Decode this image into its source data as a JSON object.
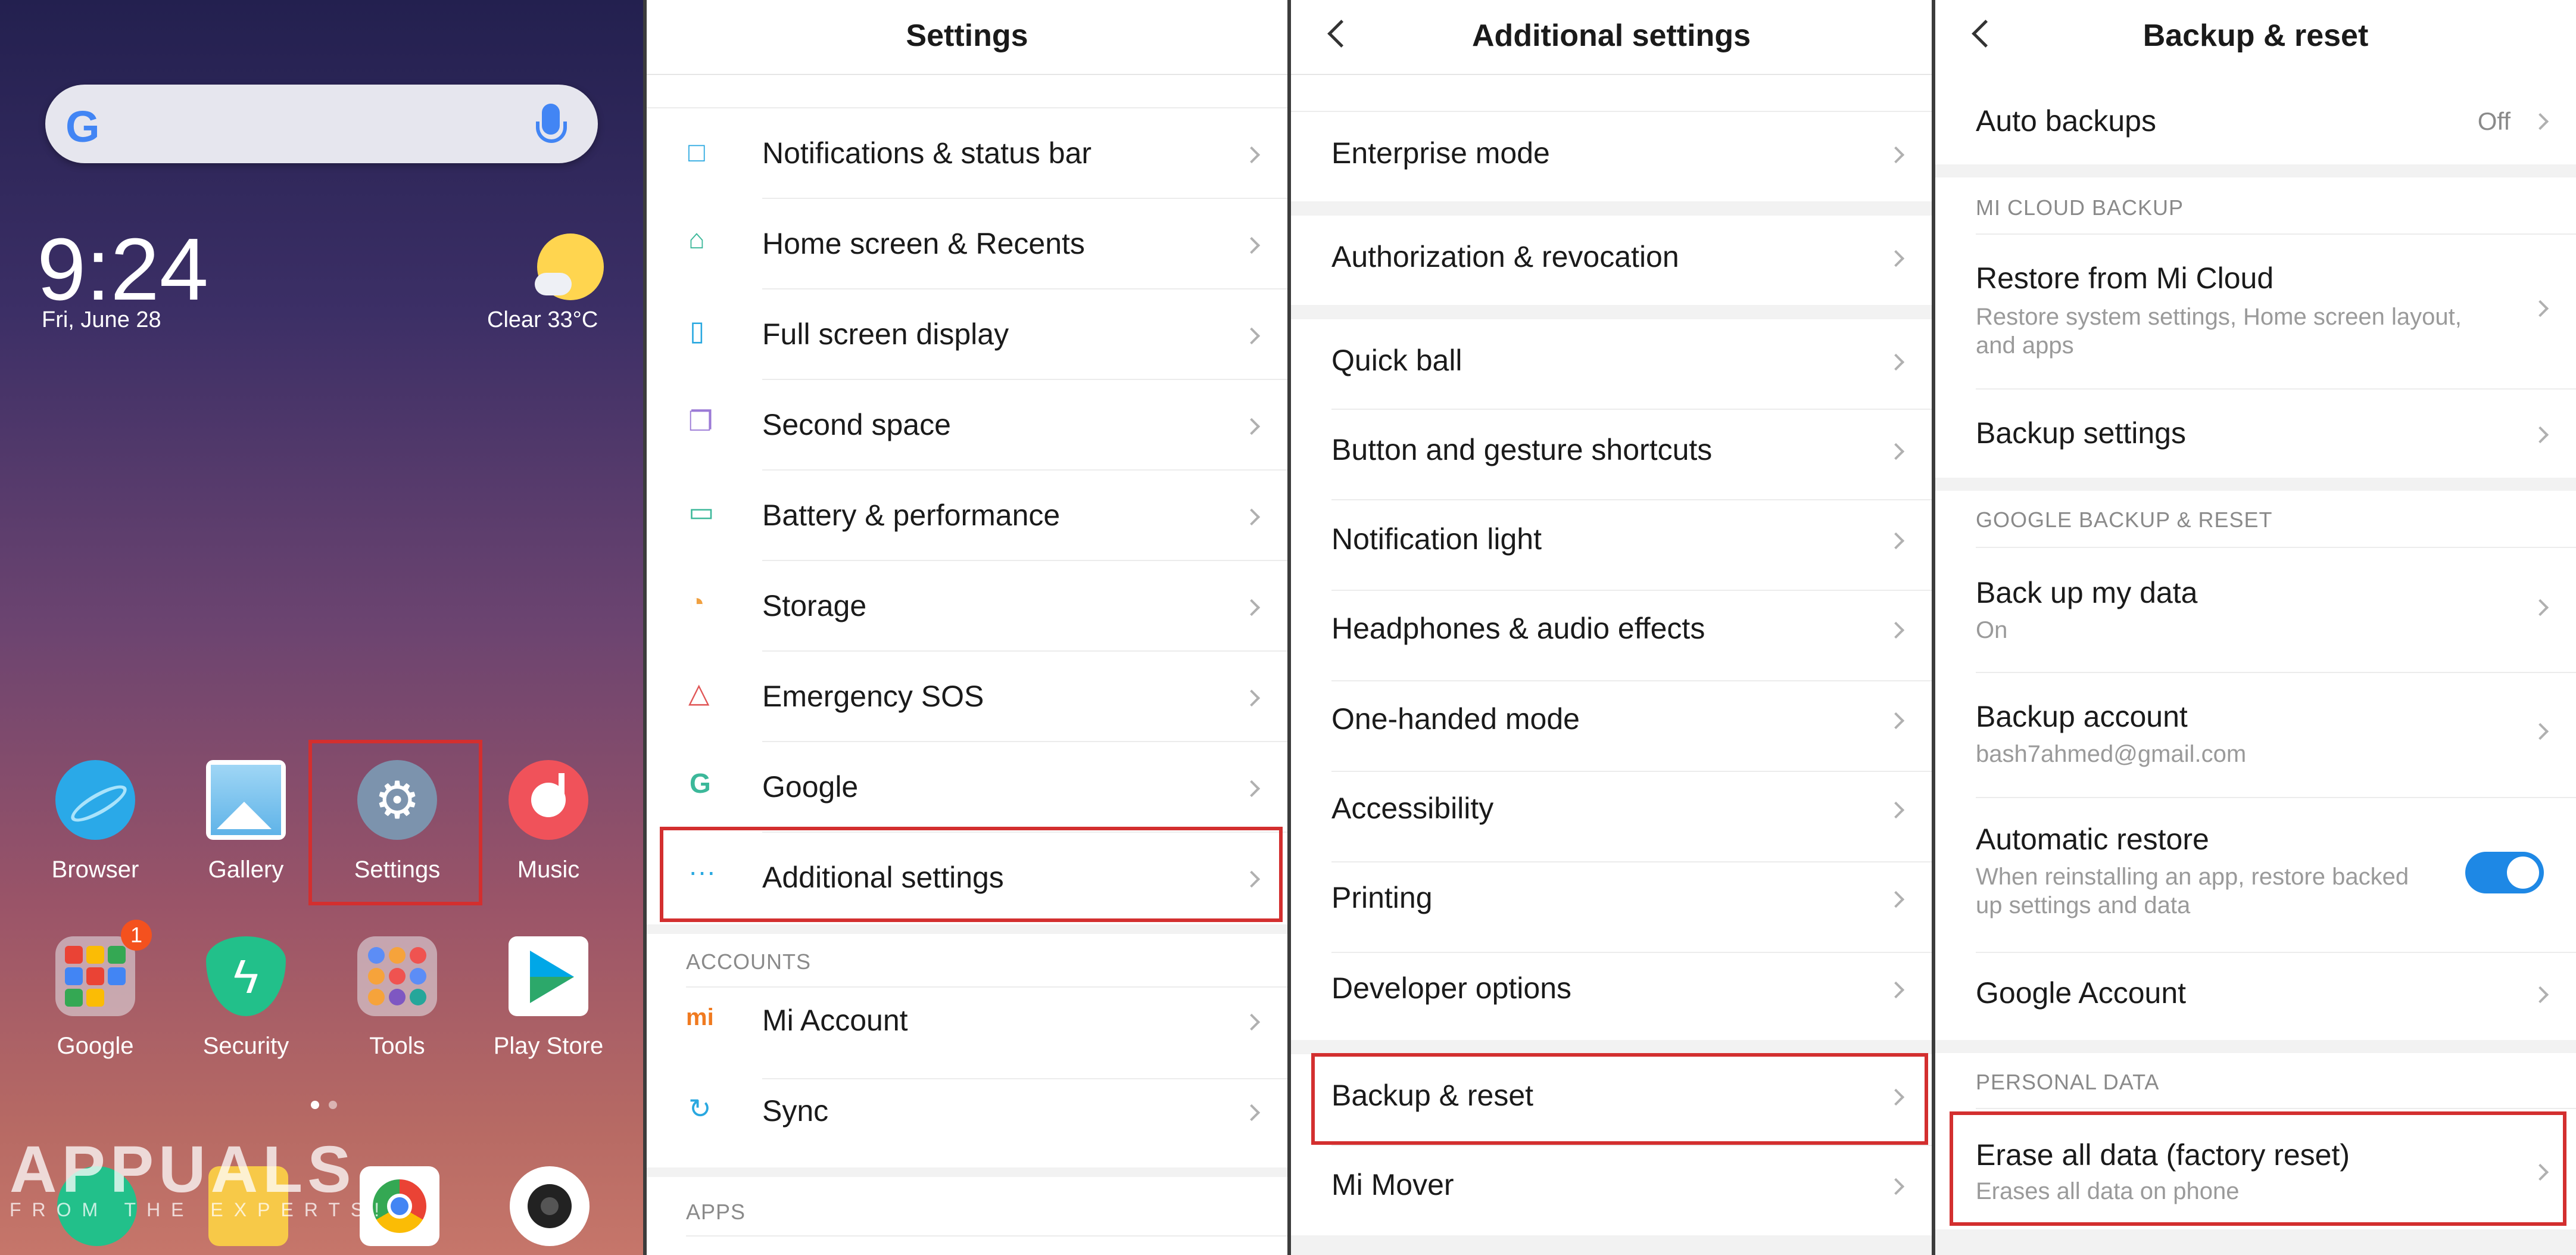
{
  "home": {
    "search_logo": "G",
    "time": "9:24",
    "date": "Fri, June 28",
    "weather": "Clear   33°C",
    "apps_row1": [
      {
        "label": "Browser",
        "color": "#2aa9e8"
      },
      {
        "label": "Gallery",
        "color": "#5fb3e8"
      },
      {
        "label": "Settings",
        "color": "#7c93ad"
      },
      {
        "label": "Music",
        "color": "#f0525a"
      }
    ],
    "apps_row2": [
      {
        "label": "Google",
        "color": "#cfcfd4"
      },
      {
        "label": "Security",
        "color": "#22c08a"
      },
      {
        "label": "Tools",
        "color": "#cfcfd4"
      },
      {
        "label": "Play Store",
        "color": "#ffffff"
      }
    ],
    "google_badge": "1",
    "watermark": {
      "main": "APPUALS",
      "sub": "FROM THE EXPERTS!"
    },
    "icons": {
      "settings": "gear-icon",
      "music": "music-note-icon",
      "security": "shield-bolt-icon",
      "play": "play-triangle-icon",
      "camera": "camera-icon"
    },
    "highlight_color": "#d32f2f"
  },
  "settings": {
    "title": "Settings",
    "items": [
      {
        "label": "Notifications & status bar",
        "icon": "□",
        "color": "#29a8e0"
      },
      {
        "label": "Home screen & Recents",
        "icon": "⌂",
        "color": "#3cb89a"
      },
      {
        "label": "Full screen display",
        "icon": "▯",
        "color": "#29a8e0"
      },
      {
        "label": "Second space",
        "icon": "❐",
        "color": "#9b7ad6"
      },
      {
        "label": "Battery & performance",
        "icon": "▭",
        "color": "#3cb89a"
      },
      {
        "label": "Storage",
        "icon": "◔",
        "color": "#f0a040"
      },
      {
        "label": "Emergency SOS",
        "icon": "△",
        "color": "#e05555"
      },
      {
        "label": "Google",
        "icon": "G",
        "color": "#3cb89a"
      },
      {
        "label": "Additional settings",
        "icon": "···",
        "color": "#29a8e0"
      }
    ],
    "accounts_header": "ACCOUNTS",
    "accounts": [
      {
        "label": "Mi Account",
        "icon": "mi",
        "color": "#f07a20"
      },
      {
        "label": "Sync",
        "icon": "↻",
        "color": "#29a8e0"
      }
    ],
    "apps_header": "APPS"
  },
  "additional": {
    "title": "Additional settings",
    "group1": [
      "Enterprise mode"
    ],
    "group2": [
      "Authorization & revocation"
    ],
    "group3": [
      "Quick ball",
      "Button and gesture shortcuts",
      "Notification light",
      "Headphones & audio effects",
      "One-handed mode",
      "Accessibility",
      "Printing",
      "Developer options"
    ],
    "group4": [
      "Backup & reset",
      "Mi Mover"
    ]
  },
  "backup": {
    "title": "Backup & reset",
    "auto_backups": {
      "label": "Auto backups",
      "value": "Off"
    },
    "mi_cloud_header": "MI CLOUD BACKUP",
    "restore_mi_cloud": {
      "label": "Restore from Mi Cloud",
      "sub1": "Restore system settings, Home screen layout,",
      "sub2": "and apps"
    },
    "backup_settings": "Backup settings",
    "google_header": "GOOGLE BACKUP & RESET",
    "back_up_my_data": {
      "label": "Back up my data",
      "sub": "On"
    },
    "backup_account": {
      "label": "Backup account",
      "sub": "bash7ahmed@gmail.com"
    },
    "automatic_restore": {
      "label": "Automatic restore",
      "sub1": "When reinstalling an app, restore backed",
      "sub2": "up settings and data",
      "enabled": true
    },
    "google_account": "Google Account",
    "personal_header": "PERSONAL DATA",
    "erase": {
      "label": "Erase all data (factory reset)",
      "sub": "Erases all data on phone"
    }
  }
}
